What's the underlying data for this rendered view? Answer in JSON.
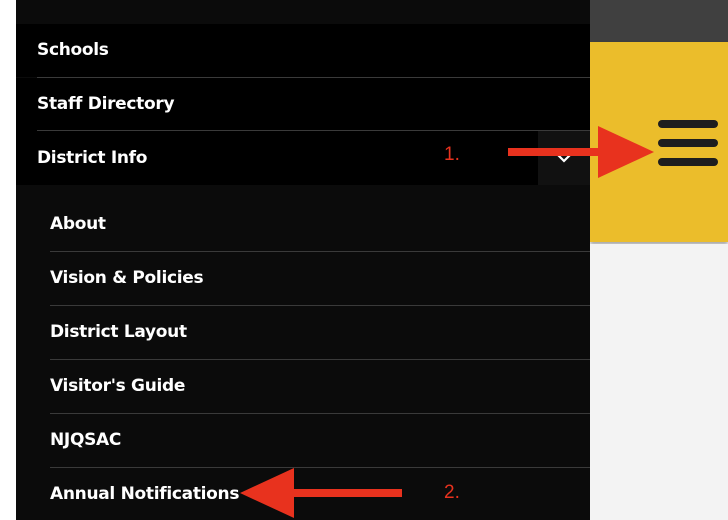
{
  "menu": {
    "top_items": [
      {
        "label": "Schools"
      },
      {
        "label": "Staff Directory"
      },
      {
        "label": "District Info"
      }
    ],
    "submenu_items": [
      {
        "label": "About"
      },
      {
        "label": "Vision & Policies"
      },
      {
        "label": "District Layout"
      },
      {
        "label": "Visitor's Guide"
      },
      {
        "label": "NJQSAC"
      },
      {
        "label": "Annual Notifications"
      }
    ],
    "expand_icon": "chevron-down-icon"
  },
  "header": {
    "menu_icon": "hamburger-menu-icon",
    "accent_color": "#ebbd2b"
  },
  "annotations": {
    "step1": "1.",
    "step2": "2.",
    "arrow_color": "#e8321e"
  }
}
